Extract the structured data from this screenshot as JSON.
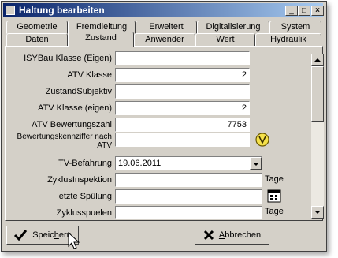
{
  "window": {
    "title": "Haltung bearbeiten"
  },
  "title_buttons": [
    "_",
    "□",
    "×"
  ],
  "tabs_back": [
    "Geometrie",
    "Fremdleitung",
    "Erweitert",
    "Digitalisierung",
    "System"
  ],
  "tabs_front": [
    "Daten",
    "Zustand",
    "Anwender",
    "Wert",
    "Hydraulik"
  ],
  "active_tab": "Zustand",
  "fields": [
    {
      "label": "ISYBau Klasse (Eigen)",
      "value": ""
    },
    {
      "label": "ATV Klasse",
      "value": "2"
    },
    {
      "label": "ZustandSubjektiv",
      "value": ""
    },
    {
      "label": "ATV Klasse (eigen)",
      "value": "2"
    },
    {
      "label": "ATV Bewertungszahl",
      "value": "7753"
    },
    {
      "label": "Bewertungskennziffer nach ATV",
      "value": ""
    },
    {
      "label": "TV-Befahrung",
      "value": "19.06.2011"
    },
    {
      "label": "ZyklusInspektion",
      "value": "",
      "unit": "Tage"
    },
    {
      "label": "letzte Spülung",
      "value": ""
    },
    {
      "label": "Zyklusspuelen",
      "value": "",
      "unit": "Tage"
    }
  ],
  "buttons": {
    "save": {
      "pre": "Speic",
      "hotkey": "h",
      "post": "ern"
    },
    "cancel": {
      "pre": "",
      "hotkey": "A",
      "post": "bbrechen"
    }
  }
}
